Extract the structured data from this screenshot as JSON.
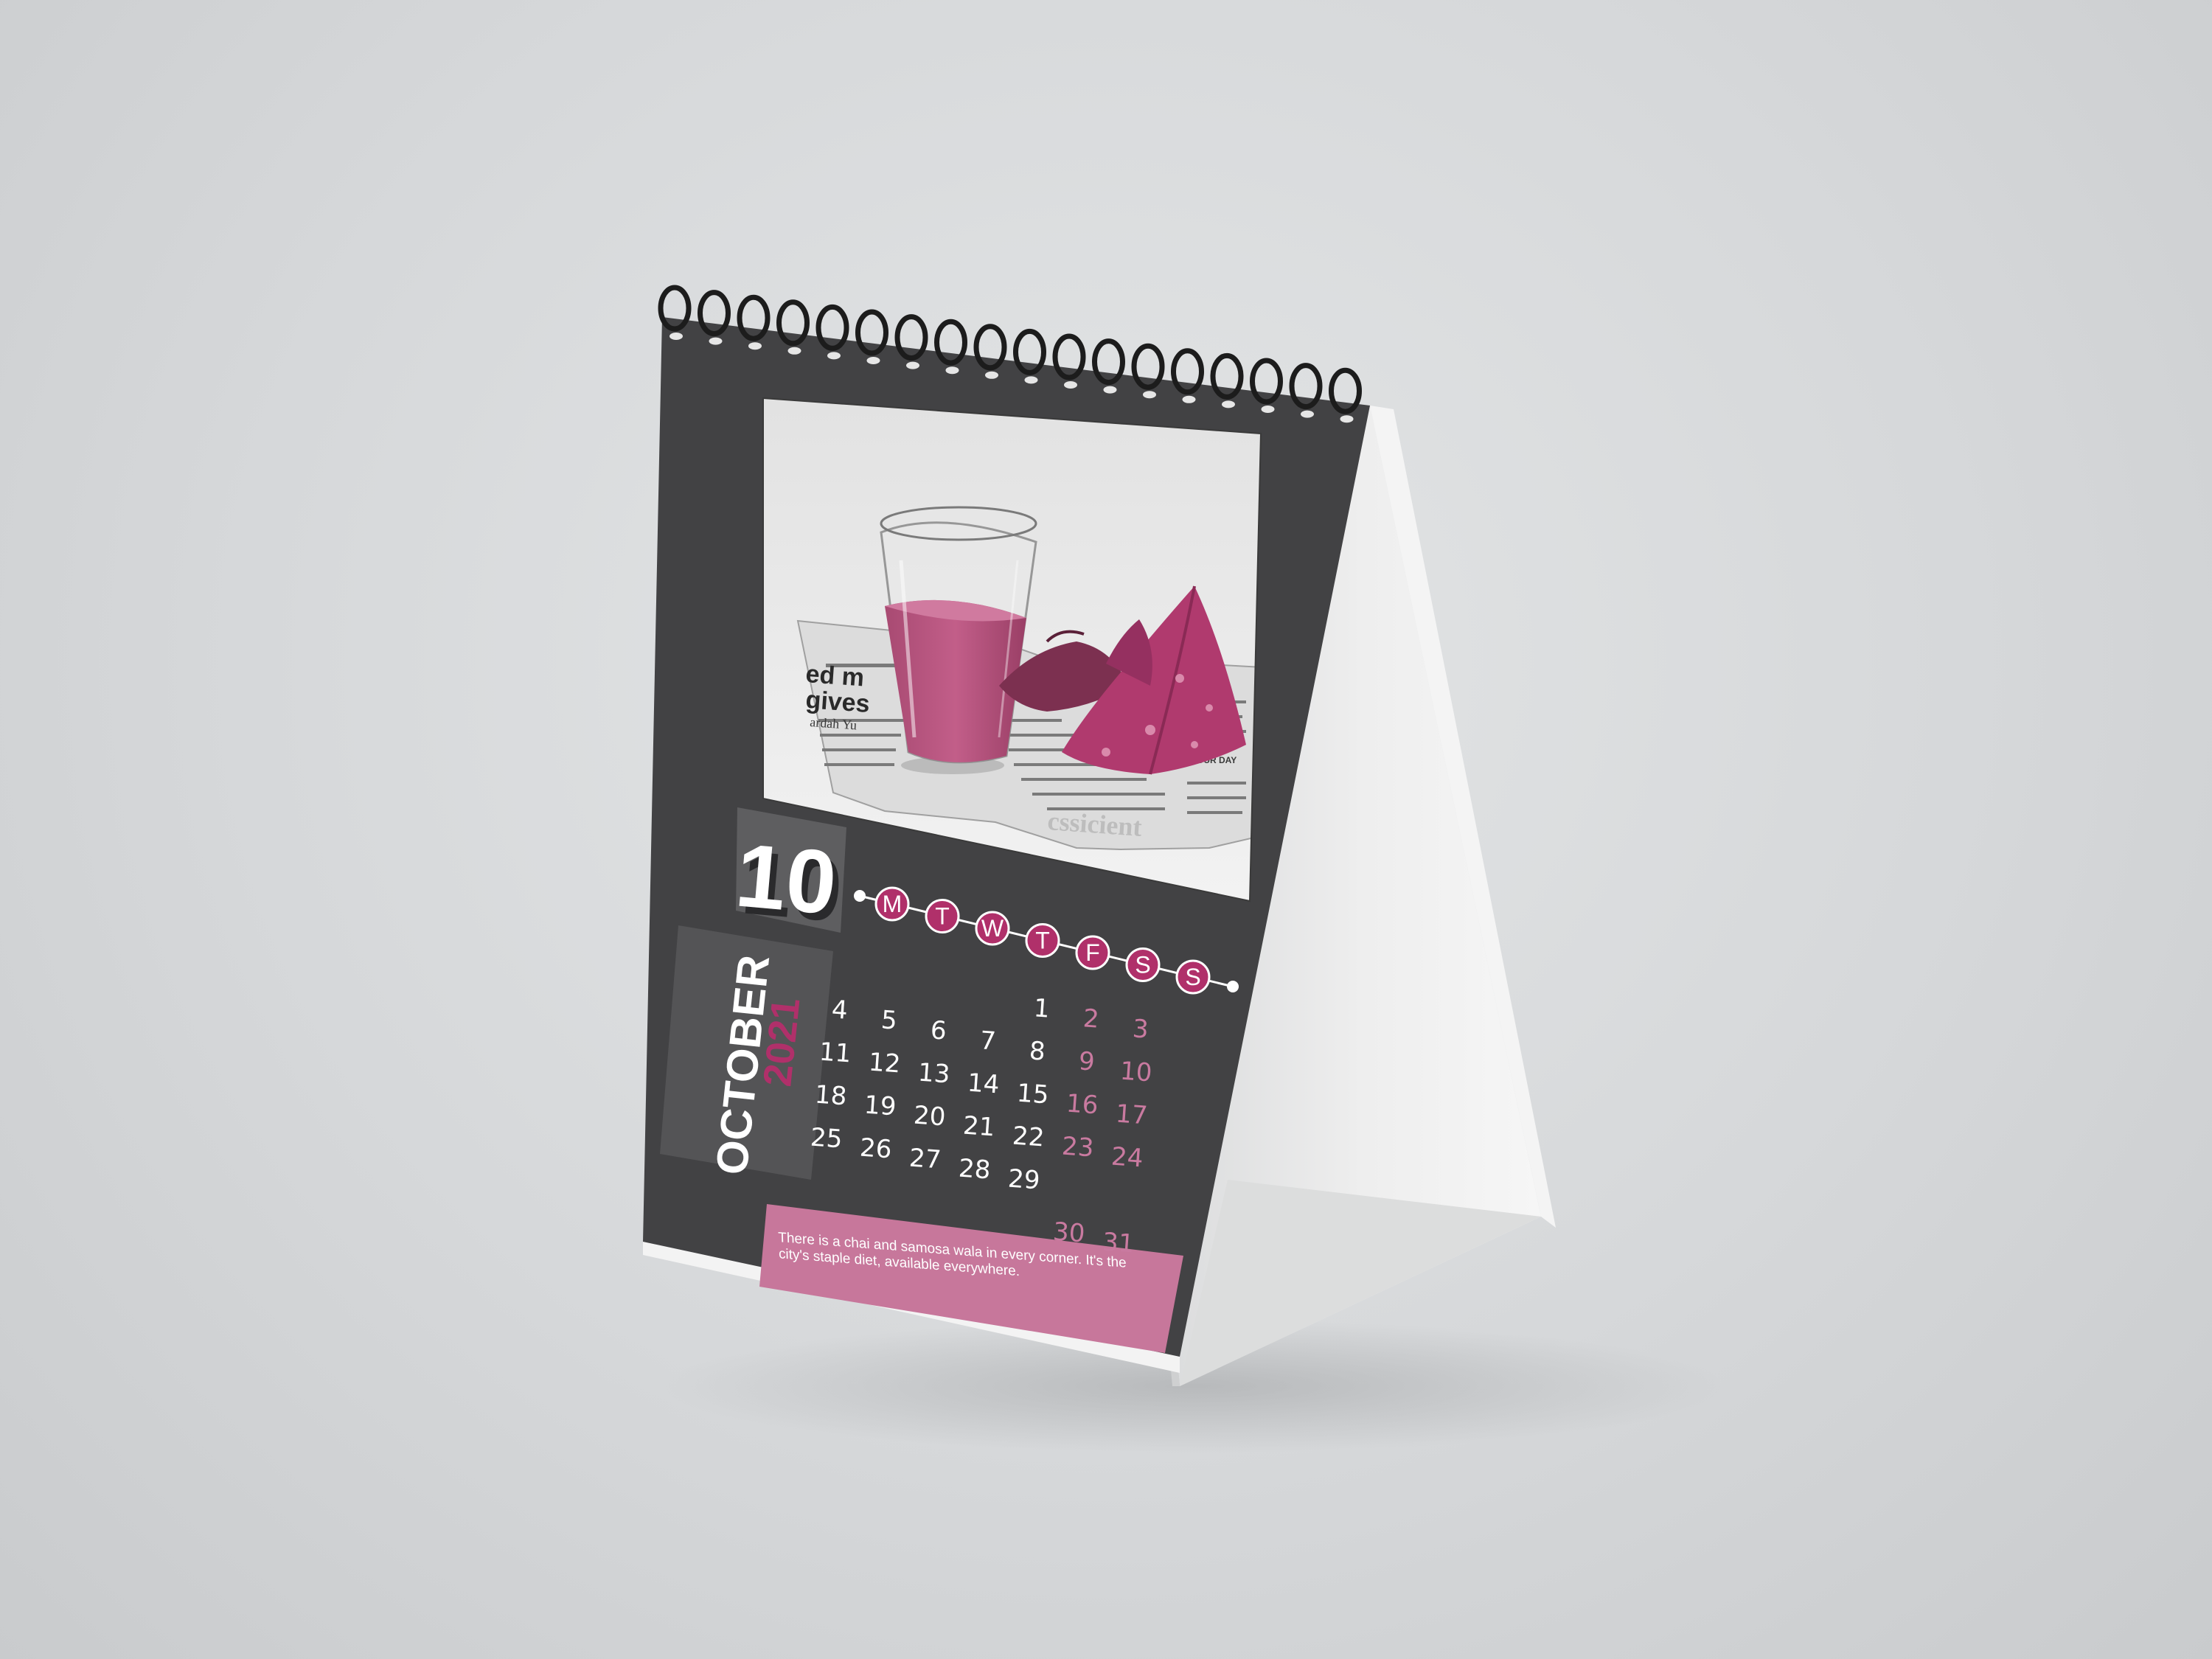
{
  "calendar": {
    "month_number": "10",
    "month_name": "OCTOBER",
    "year": "2021",
    "weekdays": [
      "M",
      "T",
      "W",
      "T",
      "F",
      "S",
      "S"
    ],
    "days": [
      {
        "day": "1",
        "col": 4,
        "row": 0,
        "weekend": false
      },
      {
        "day": "2",
        "col": 5,
        "row": 0,
        "weekend": true
      },
      {
        "day": "3",
        "col": 6,
        "row": 0,
        "weekend": true
      },
      {
        "day": "4",
        "col": 0,
        "row": 1,
        "weekend": false
      },
      {
        "day": "5",
        "col": 1,
        "row": 1,
        "weekend": false
      },
      {
        "day": "6",
        "col": 2,
        "row": 1,
        "weekend": false
      },
      {
        "day": "7",
        "col": 3,
        "row": 1,
        "weekend": false
      },
      {
        "day": "8",
        "col": 4,
        "row": 1,
        "weekend": false
      },
      {
        "day": "9",
        "col": 5,
        "row": 1,
        "weekend": true
      },
      {
        "day": "10",
        "col": 6,
        "row": 1,
        "weekend": true
      },
      {
        "day": "11",
        "col": 0,
        "row": 2,
        "weekend": false
      },
      {
        "day": "12",
        "col": 1,
        "row": 2,
        "weekend": false
      },
      {
        "day": "13",
        "col": 2,
        "row": 2,
        "weekend": false
      },
      {
        "day": "14",
        "col": 3,
        "row": 2,
        "weekend": false
      },
      {
        "day": "15",
        "col": 4,
        "row": 2,
        "weekend": false
      },
      {
        "day": "16",
        "col": 5,
        "row": 2,
        "weekend": true
      },
      {
        "day": "17",
        "col": 6,
        "row": 2,
        "weekend": true
      },
      {
        "day": "18",
        "col": 0,
        "row": 3,
        "weekend": false
      },
      {
        "day": "19",
        "col": 1,
        "row": 3,
        "weekend": false
      },
      {
        "day": "20",
        "col": 2,
        "row": 3,
        "weekend": false
      },
      {
        "day": "21",
        "col": 3,
        "row": 3,
        "weekend": false
      },
      {
        "day": "22",
        "col": 4,
        "row": 3,
        "weekend": false
      },
      {
        "day": "23",
        "col": 5,
        "row": 3,
        "weekend": true
      },
      {
        "day": "24",
        "col": 6,
        "row": 3,
        "weekend": true
      },
      {
        "day": "25",
        "col": 0,
        "row": 4,
        "weekend": false
      },
      {
        "day": "26",
        "col": 1,
        "row": 4,
        "weekend": false
      },
      {
        "day": "27",
        "col": 2,
        "row": 4,
        "weekend": false
      },
      {
        "day": "28",
        "col": 3,
        "row": 4,
        "weekend": false
      },
      {
        "day": "29",
        "col": 4,
        "row": 4,
        "weekend": false
      },
      {
        "day": "30",
        "col": 5,
        "row": 5,
        "weekend": true
      },
      {
        "day": "31",
        "col": 6,
        "row": 5,
        "weekend": true
      }
    ],
    "caption": "There is a chai and samosa wala in every corner. It's the city's staple diet, available everywhere."
  },
  "photo": {
    "subject": "glass of chai and samosas on newspaper",
    "newspaper_fragments": [
      "ed m",
      "gives",
      "ardah Yu",
      "day",
      "YOUR DAY"
    ]
  },
  "colors": {
    "background": "#d8dadb",
    "page": "#424244",
    "panel_dark": "#2f2f31",
    "panel_mid": "#5a5a5c",
    "accent": "#b0306a",
    "accent_soft": "#c97aa0",
    "caption_band": "#c7779b",
    "ring": "#1c1c1c",
    "stand": "#ececec"
  },
  "icons": {
    "binding": "spiral-binding-icon",
    "weekday_marker": "circle-badge-icon"
  }
}
